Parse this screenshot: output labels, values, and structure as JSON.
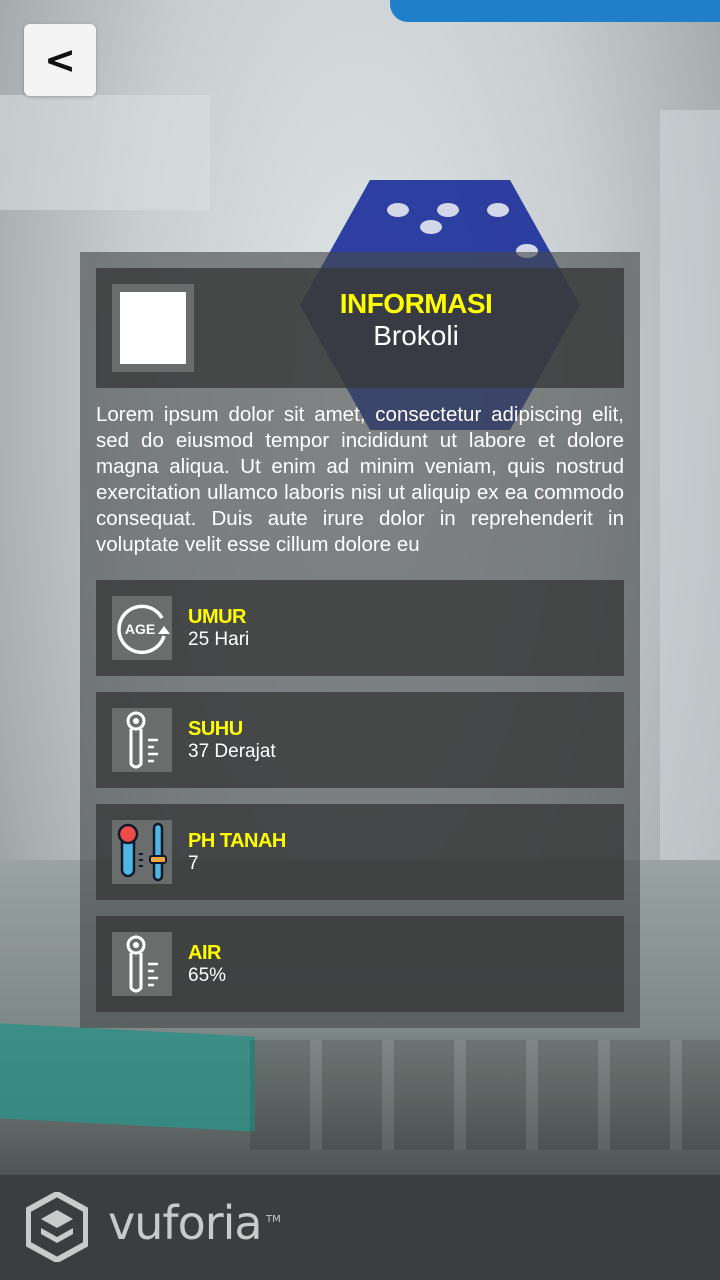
{
  "navigation": {
    "back_label": "<"
  },
  "header": {
    "title": "INFORMASI",
    "subtitle": "Brokoli"
  },
  "description": "Lorem ipsum dolor sit amet, consectetur adipiscing elit, sed do eiusmod tempor incididunt ut labore et dolore magna aliqua. Ut enim ad minim veniam, quis nostrud exercitation ullamco laboris nisi ut aliquip ex ea commodo consequat. Duis aute irure dolor in reprehenderit in voluptate velit esse cillum dolore eu",
  "stats": [
    {
      "label": "UMUR",
      "value": "25 Hari",
      "icon": "age-icon"
    },
    {
      "label": "SUHU",
      "value": "37 Derajat",
      "icon": "thermometer-icon"
    },
    {
      "label": "PH TANAH",
      "value": "7",
      "icon": "ph-meter-icon"
    },
    {
      "label": "AIR",
      "value": "65%",
      "icon": "thermometer-icon"
    }
  ],
  "icons": {
    "age_text": "AGE"
  },
  "branding": {
    "name": "vuforia",
    "trademark": "TM"
  },
  "colors": {
    "title_yellow": "#ffff00",
    "panel_bg": "#464848",
    "text_white": "#ffffff"
  }
}
